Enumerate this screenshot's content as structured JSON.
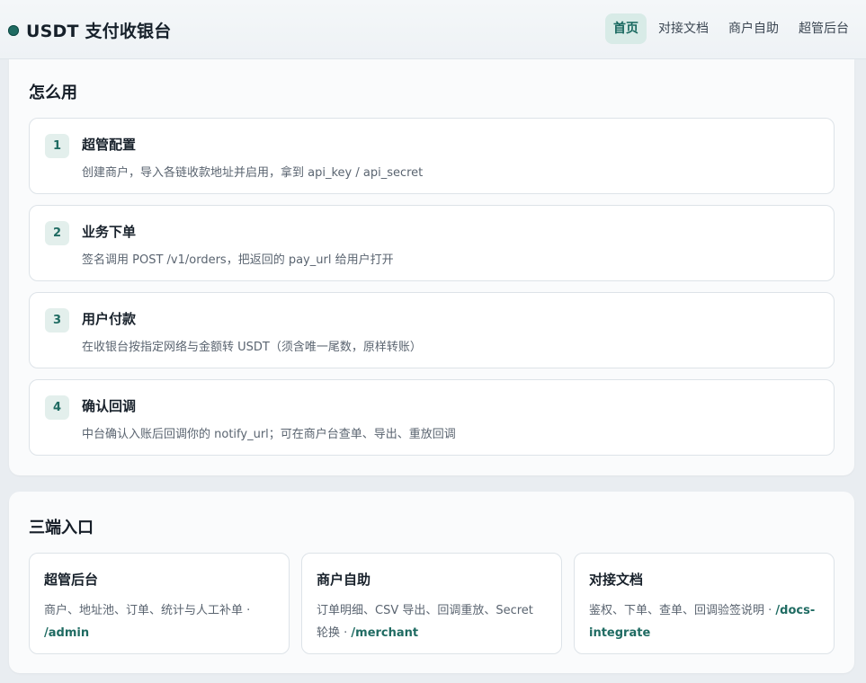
{
  "header": {
    "title": "USDT 支付收银台",
    "nav": [
      {
        "label": "首页",
        "active": true
      },
      {
        "label": "对接文档",
        "active": false
      },
      {
        "label": "商户自助",
        "active": false
      },
      {
        "label": "超管后台",
        "active": false
      }
    ]
  },
  "howto": {
    "title": "怎么用",
    "steps": [
      {
        "num": "1",
        "title": "超管配置",
        "desc": "创建商户，导入各链收款地址并启用，拿到 api_key / api_secret"
      },
      {
        "num": "2",
        "title": "业务下单",
        "desc": "签名调用 POST /v1/orders，把返回的 pay_url 给用户打开"
      },
      {
        "num": "3",
        "title": "用户付款",
        "desc": "在收银台按指定网络与金额转 USDT（须含唯一尾数，原样转账）"
      },
      {
        "num": "4",
        "title": "确认回调",
        "desc": "中台确认入账后回调你的 notify_url；可在商户台查单、导出、重放回调"
      }
    ]
  },
  "entries": {
    "title": "三端入口",
    "items": [
      {
        "title": "超管后台",
        "desc": "商户、地址池、订单、统计与人工补单 · ",
        "path": "/admin"
      },
      {
        "title": "商户自助",
        "desc": "订单明细、CSV 导出、回调重放、Secret 轮换 · ",
        "path": "/merchant"
      },
      {
        "title": "对接文档",
        "desc": "鉴权、下单、查单、回调验签说明 · ",
        "path": "/docs-integrate"
      }
    ]
  },
  "colors": {
    "accent": "#1f6b62",
    "accent_bg": "#d8ebe7",
    "page_bg": "#e9edf1"
  }
}
